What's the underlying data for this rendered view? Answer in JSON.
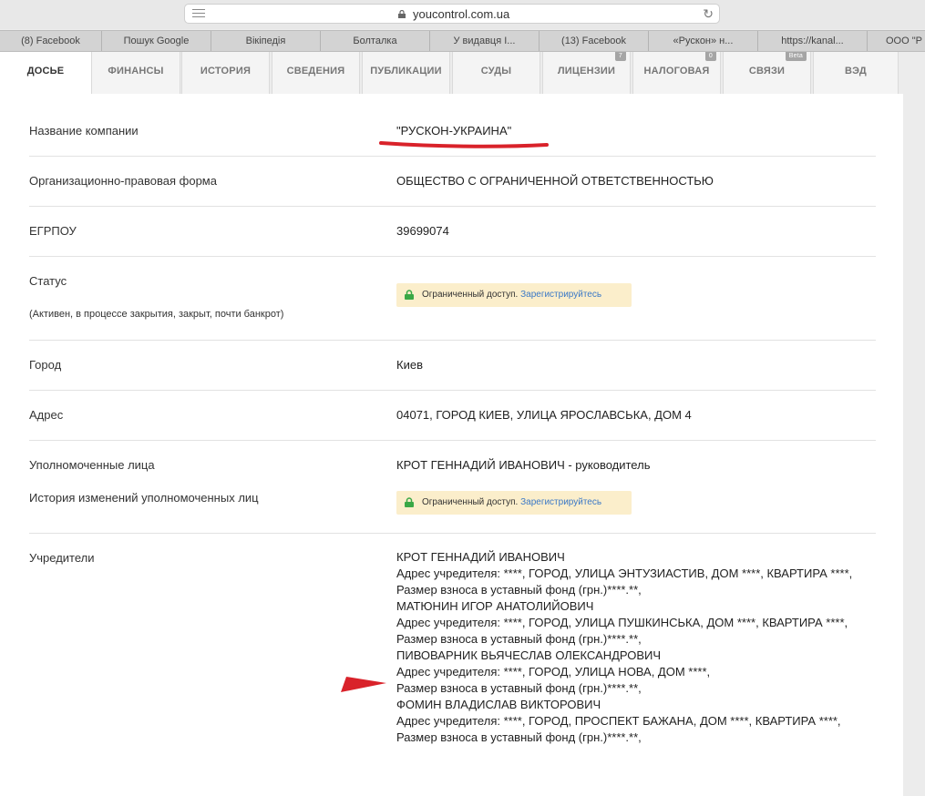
{
  "browser": {
    "url": "youcontrol.com.ua",
    "bookmarks": [
      "(8) Facebook",
      "Пошук Google",
      "Вікіпедія",
      "Болталка",
      "У видавця І...",
      "(13) Facebook",
      "«Рускон» н...",
      "https://kanal...",
      "ООО \"Р"
    ]
  },
  "tabs": [
    {
      "label": "ДОСЬЕ",
      "active": true
    },
    {
      "label": "ФИНАНСЫ"
    },
    {
      "label": "ИСТОРИЯ"
    },
    {
      "label": "СВЕДЕНИЯ"
    },
    {
      "label": "ПУБЛИКАЦИИ"
    },
    {
      "label": "СУДЫ"
    },
    {
      "label": "ЛИЦЕНЗИИ",
      "badge": "7"
    },
    {
      "label": "НАЛОГОВАЯ",
      "badge": "0"
    },
    {
      "label": "СВЯЗИ",
      "badge": "Beta"
    },
    {
      "label": "ВЭД"
    }
  ],
  "restricted": {
    "text": "Ограниченный доступ.",
    "link": "Зарегистрируйтесь"
  },
  "rows": {
    "name": {
      "label": "Название компании",
      "value": "\"РУСКОН-УКРАИНА\""
    },
    "form": {
      "label": "Организационно-правовая форма",
      "value": "ОБЩЕСТВО С ОГРАНИЧЕННОЙ ОТВЕТСТВЕННОСТЬЮ"
    },
    "edrpou": {
      "label": "ЕГРПОУ",
      "value": "39699074"
    },
    "status": {
      "label": "Статус",
      "note": "(Активен, в процессе закрытия, закрыт, почти банкрот)"
    },
    "city": {
      "label": "Город",
      "value": "Киев"
    },
    "address": {
      "label": "Адрес",
      "value": "04071, ГОРОД КИЕВ, УЛИЦА ЯРОСЛАВСЬКА, ДОМ 4"
    },
    "persons": {
      "label": "Уполномоченные лица",
      "value": "КРОТ ГЕННАДИЙ ИВАНОВИЧ - руководитель",
      "history_label": "История изменений уполномоченных лиц"
    },
    "founders": {
      "label": "Учредители"
    }
  },
  "founders": [
    {
      "name": "КРОТ ГЕННАДИЙ ИВАНОВИЧ",
      "address": "Адрес учредителя: ****, ГОРОД, УЛИЦА ЭНТУЗИАСТИВ, ДОМ ****, КВАРТИРА ****,",
      "fund": "Размер взноса в уставный фонд (грн.)****.**,"
    },
    {
      "name": "МАТЮНИН ИГОР АНАТОЛИЙОВИЧ",
      "address": "Адрес учредителя: ****, ГОРОД, УЛИЦА ПУШКИНСЬКА, ДОМ ****, КВАРТИРА ****,",
      "fund": "Размер взноса в уставный фонд (грн.)****.**,"
    },
    {
      "name": "ПИВОВАРНИК ВЬЯЧЕСЛАВ ОЛЕКСАНДРОВИЧ",
      "address": "Адрес учредителя: ****, ГОРОД, УЛИЦА НОВА, ДОМ ****,",
      "fund": "Размер взноса в уставный фонд (грн.)****.**,"
    },
    {
      "name": "ФОМИН ВЛАДИСЛАВ ВИКТОРОВИЧ",
      "address": "Адрес учредителя: ****, ГОРОД, ПРОСПЕКТ БАЖАНА, ДОМ ****, КВАРТИРА ****,",
      "fund": "Размер взноса в уставный фонд (грн.)****.**,"
    }
  ],
  "colors": {
    "annotation": "#d9222a",
    "link": "#3a78c6",
    "restricted_bg": "#fbeecb",
    "lock": "#3aa846"
  }
}
